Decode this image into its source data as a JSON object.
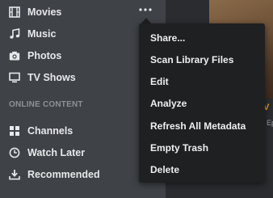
{
  "sidebar": {
    "items": [
      {
        "label": "Movies",
        "icon": "film-icon"
      },
      {
        "label": "Music",
        "icon": "music-note-icon"
      },
      {
        "label": "Photos",
        "icon": "camera-icon"
      },
      {
        "label": "TV Shows",
        "icon": "monitor-icon"
      }
    ],
    "section_header": "ONLINE CONTENT",
    "online_items": [
      {
        "label": "Channels",
        "icon": "grid-icon"
      },
      {
        "label": "Watch Later",
        "icon": "clock-icon"
      },
      {
        "label": "Recommended",
        "icon": "download-icon"
      }
    ],
    "more_icon": "more-horizontal-icon"
  },
  "context_menu": {
    "items": [
      "Share...",
      "Scan Library Files",
      "Edit",
      "Analyze",
      "Refresh All Metadata",
      "Empty Trash",
      "Delete"
    ]
  },
  "colors": {
    "sidebar_bg": "#3f4247",
    "menu_bg": "#1f2022",
    "text": "#e7e8ea",
    "section_header": "#8e9197",
    "accent": "#e5a00d"
  }
}
